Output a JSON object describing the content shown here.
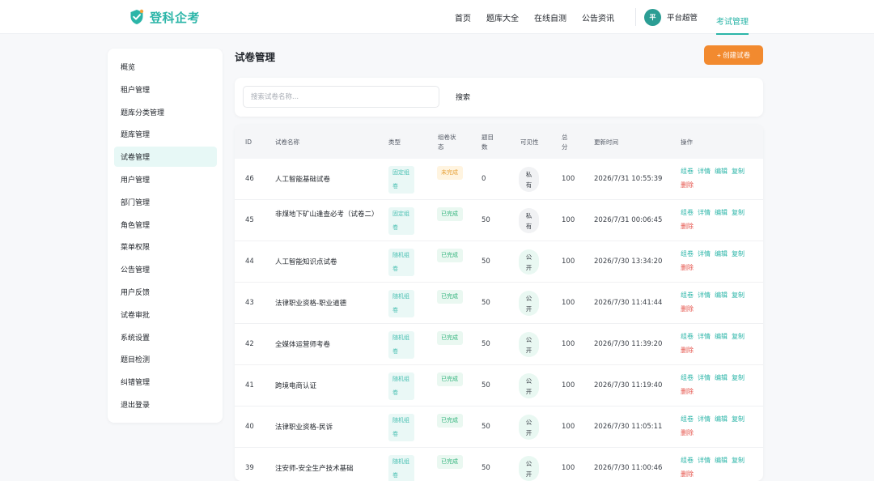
{
  "brand": {
    "name": "登科企考",
    "color": "#2bb5a8"
  },
  "nav": {
    "links": [
      "首页",
      "题库大全",
      "在线自测",
      "公告资讯"
    ],
    "user_avatar": "平",
    "user_name": "平台超管",
    "active": "考试管理"
  },
  "sidebar": {
    "items": [
      "概览",
      "租户管理",
      "题库分类管理",
      "题库管理",
      "试卷管理",
      "用户管理",
      "部门管理",
      "角色管理",
      "菜单权限",
      "公告管理",
      "用户反馈",
      "试卷审批",
      "系统设置",
      "题目检测",
      "纠错管理"
    ],
    "active_index": 4,
    "logout": "退出登录"
  },
  "page": {
    "title": "试卷管理",
    "create_button": "+ 创建试卷",
    "accent": "#f28a2f"
  },
  "search": {
    "placeholder": "搜索试卷名称...",
    "button": "搜索"
  },
  "table": {
    "headers": {
      "id": "ID",
      "name": "试卷名称",
      "type": "类型",
      "status": "组卷状态",
      "count": "题目数",
      "visibility": "可见性",
      "score": "总分",
      "updated": "更新时间",
      "actions": "操作"
    },
    "actions": {
      "build": "组卷",
      "detail": "详情",
      "edit": "编辑",
      "copy": "复制",
      "delete": "删除"
    },
    "rows": [
      {
        "id": "46",
        "name": "人工智能基础试卷",
        "type": "固定组卷",
        "status": "未完成",
        "count": "0",
        "visibility": "私有",
        "score": "100",
        "updated": "2026/7/31 10:55:39"
      },
      {
        "id": "45",
        "name": "非煤地下矿山逢查必考（试卷二）",
        "type": "固定组卷",
        "status": "已完成",
        "count": "50",
        "visibility": "私有",
        "score": "100",
        "updated": "2026/7/31 00:06:45"
      },
      {
        "id": "44",
        "name": "人工智能知识点试卷",
        "type": "随机组卷",
        "status": "已完成",
        "count": "50",
        "visibility": "公开",
        "score": "100",
        "updated": "2026/7/30 13:34:20"
      },
      {
        "id": "43",
        "name": "法律职业资格-职业道德",
        "type": "随机组卷",
        "status": "已完成",
        "count": "50",
        "visibility": "公开",
        "score": "100",
        "updated": "2026/7/30 11:41:44"
      },
      {
        "id": "42",
        "name": "全媒体运营师考卷",
        "type": "随机组卷",
        "status": "已完成",
        "count": "50",
        "visibility": "公开",
        "score": "100",
        "updated": "2026/7/30 11:39:20"
      },
      {
        "id": "41",
        "name": "跨境电商认证",
        "type": "随机组卷",
        "status": "已完成",
        "count": "50",
        "visibility": "公开",
        "score": "100",
        "updated": "2026/7/30 11:19:40"
      },
      {
        "id": "40",
        "name": "法律职业资格-民诉",
        "type": "随机组卷",
        "status": "已完成",
        "count": "50",
        "visibility": "公开",
        "score": "100",
        "updated": "2026/7/30 11:05:11"
      },
      {
        "id": "39",
        "name": "注安师-安全生产技术基础",
        "type": "随机组卷",
        "status": "已完成",
        "count": "50",
        "visibility": "公开",
        "score": "100",
        "updated": "2026/7/30 11:00:46"
      }
    ]
  }
}
